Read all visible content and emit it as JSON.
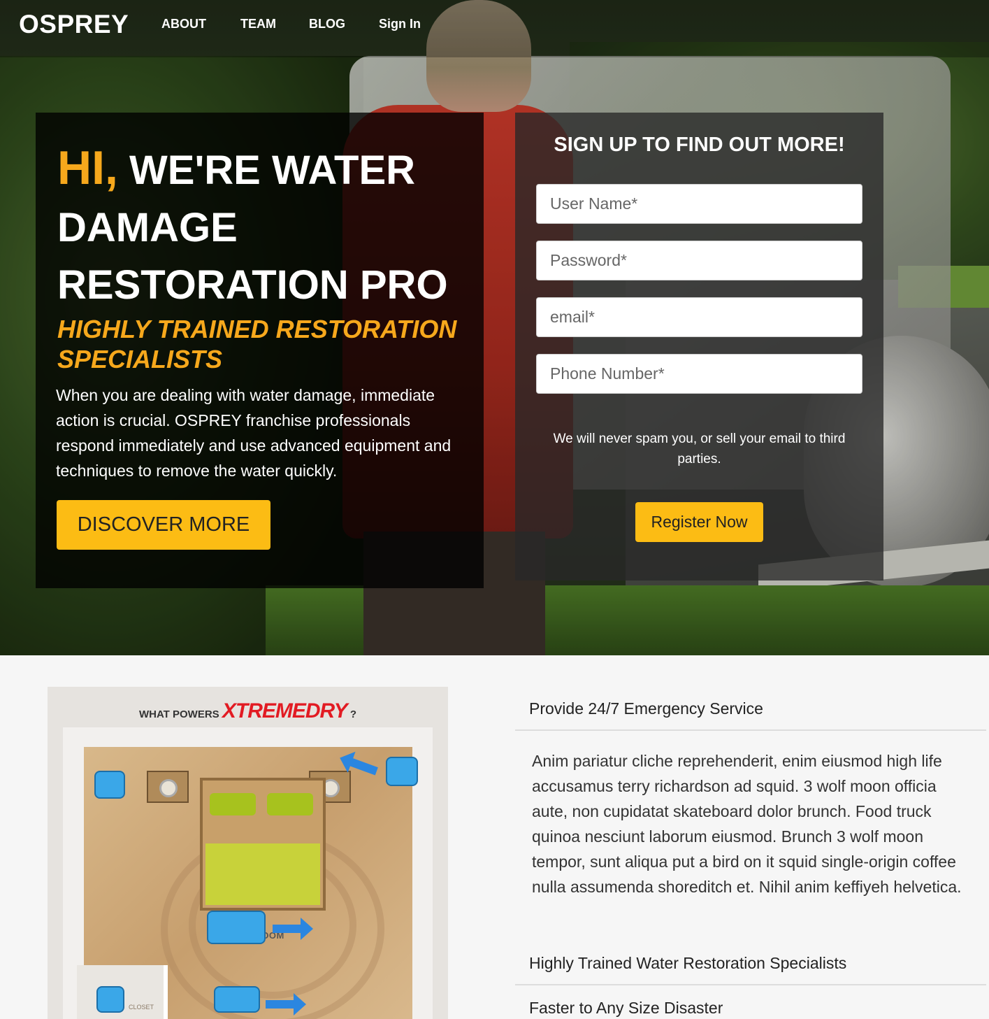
{
  "nav": {
    "logo": "OSPREY",
    "links": [
      "ABOUT",
      "TEAM",
      "BLOG",
      "Sign In"
    ]
  },
  "hero": {
    "title_hi": "HI,",
    "title_rest": "WE'RE WATER DAMAGE RESTORATION PRO",
    "subtitle": "HIGHLY TRAINED RESTORATION SPECIALISTS",
    "body": "When you are dealing with water damage, immediate action is crucial. OSPREY franchise professionals respond immediately and use advanced equipment and techniques to remove the water quickly.",
    "cta": "DISCOVER MORE"
  },
  "signup": {
    "title": "SIGN UP TO FIND OUT MORE!",
    "fields": {
      "username_placeholder": "User Name*",
      "password_placeholder": "Password*",
      "email_placeholder": "email*",
      "phone_placeholder": "Phone Number*"
    },
    "privacy": "We will never spam you, or sell your email to third parties.",
    "submit": "Register Now"
  },
  "diagram": {
    "caption_prefix": "WHAT POWERS",
    "caption_brand": "XTREMEDRY",
    "caption_suffix": "?",
    "room_label": "HOTEL ROOM",
    "closet_label": "CLOSET"
  },
  "accordion": {
    "items": [
      "Provide 24/7 Emergency Service",
      "Highly Trained Water Restoration Specialists",
      "Faster to Any Size Disaster"
    ],
    "open_body": "Anim pariatur cliche reprehenderit, enim eiusmod high life accusamus terry richardson ad squid. 3 wolf moon officia aute, non cupidatat skateboard dolor brunch. Food truck quinoa nesciunt laborum eiusmod. Brunch 3 wolf moon tempor, sunt aliqua put a bird on it squid single-origin coffee nulla assumenda shoreditch et. Nihil anim keffiyeh helvetica."
  },
  "colors": {
    "accent": "#fcbc14",
    "accent_text": "#f6a81c",
    "brand_red": "#e21b23"
  }
}
